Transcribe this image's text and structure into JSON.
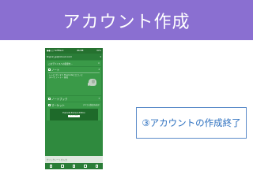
{
  "slide": {
    "title": "アカウント作成",
    "callout": "③アカウントの作成終了",
    "header_color": "#8a6fd1",
    "callout_color": "#2b6fbf"
  },
  "phone": {
    "status": {
      "carrier": "●●○○ SoftBank",
      "time": "21:33",
      "battery": "80%"
    },
    "account": {
      "email": "tkg12_jp@icloud.com"
    },
    "notice": "このデバイスへの変更を...",
    "note": {
      "label": "ノート",
      "count": "4",
      "body": "レシピ ポンすり Evernoteとエコノミ テーマ ノート... 発見"
    },
    "notebook": {
      "label": "ノートブック",
      "count": "3"
    },
    "market": {
      "label": "マーケット",
      "link": "すべての製品を表示",
      "banner_title": "Evernote Premium Edition",
      "banner_button": "詳しく見る"
    },
    "quicknote_placeholder": "クイックノートを入力"
  }
}
